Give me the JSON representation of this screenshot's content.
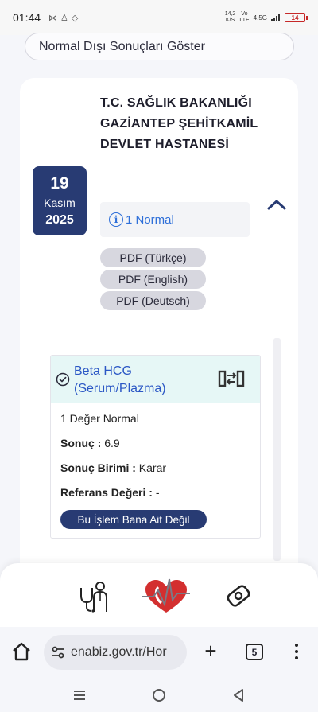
{
  "status_bar": {
    "time": "01:44",
    "net_speed_value": "14,2",
    "net_speed_unit": "K/S",
    "volte_top": "Vo",
    "volte_bottom": "LTE",
    "network_type": "4.5G",
    "battery_level": "14"
  },
  "filter": {
    "label": "Normal Dışı Sonuçları Göster"
  },
  "result": {
    "date": {
      "day": "19",
      "month": "Kasım",
      "year": "2025"
    },
    "hospital_name": "T.C. SAĞLIK BAKANLIĞI GAZİANTEP ŞEHİTKAMİL DEVLET HASTANESİ",
    "normal_summary": "1 Normal",
    "pdf_buttons": [
      "PDF (Türkçe)",
      "PDF (English)",
      "PDF (Deutsch)"
    ],
    "test": {
      "title": "Beta HCG (Serum/Plazma)",
      "status_line": "1 Değer Normal",
      "result_label": "Sonuç :",
      "result_value": "6.9",
      "unit_label": "Sonuç Birimi :",
      "unit_value": "Karar",
      "reference_label": "Referans Değeri :",
      "reference_value": "-",
      "not_mine_button": "Bu İşlem Bana Ait Değil"
    }
  },
  "browser": {
    "url": "enabiz.gov.tr/Hor",
    "tab_count": "5"
  },
  "colors": {
    "navy": "#283b73",
    "link_blue": "#2e6fd9",
    "test_header_bg": "#e6f7f6",
    "logo_red": "#d32f2f"
  }
}
